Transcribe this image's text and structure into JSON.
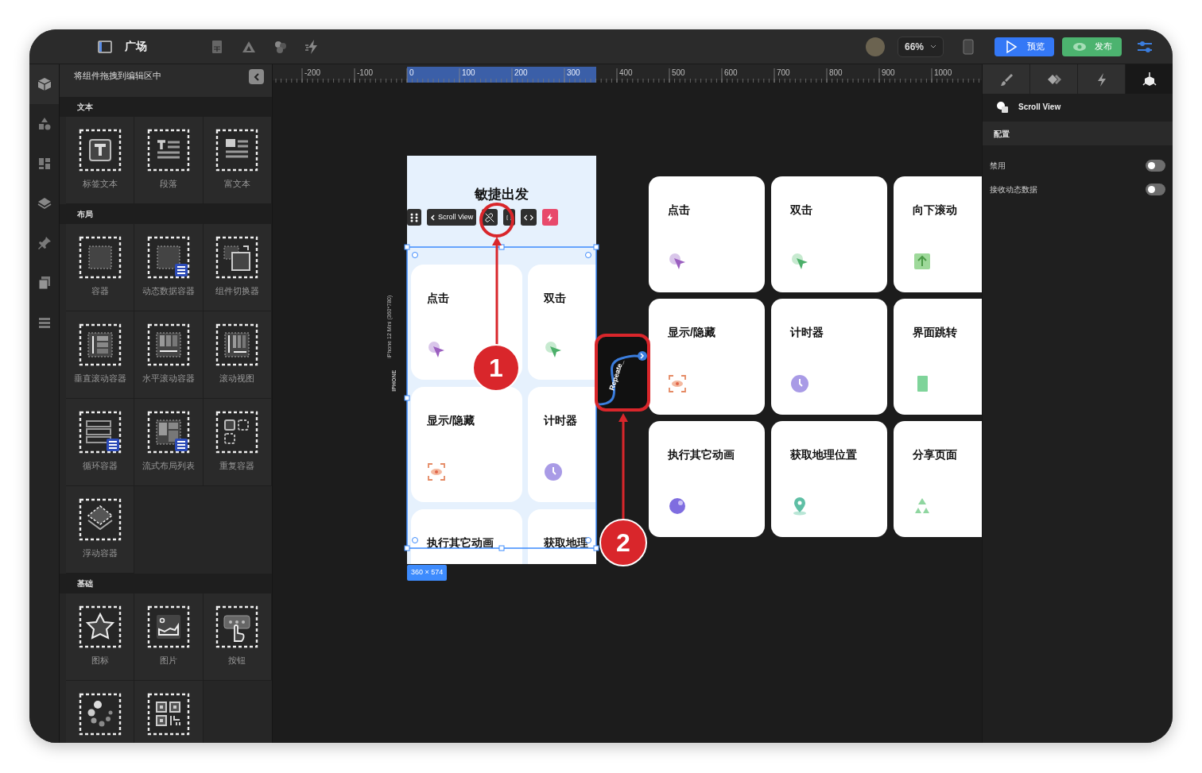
{
  "top_bar": {
    "title": "广场",
    "zoom": "66%",
    "buttons": [
      {
        "label": "预览",
        "kind": "preview"
      },
      {
        "label": "发布",
        "kind": "publish"
      }
    ]
  },
  "left_rail": [
    {
      "selected": true
    },
    {
      "selected": false
    },
    {
      "selected": false
    },
    {
      "selected": false
    },
    {
      "selected": false
    },
    {
      "selected": false
    },
    {
      "selected": false
    }
  ],
  "sidebar": {
    "title": "将组件拖拽到编辑区中",
    "sections": [
      {
        "title": "文本",
        "items": [
          {
            "label": "标签文本"
          },
          {
            "label": "段落"
          },
          {
            "label": "富文本"
          }
        ]
      },
      {
        "title": "布局",
        "items": [
          {
            "label": "容器"
          },
          {
            "label": "动态数据容器"
          },
          {
            "label": "组件切换器"
          },
          {
            "label": "垂直滚动容器"
          },
          {
            "label": "水平滚动容器"
          },
          {
            "label": "滚动视图"
          },
          {
            "label": "循环容器"
          },
          {
            "label": "流式布局列表"
          },
          {
            "label": "重复容器"
          },
          {
            "label": "浮动容器"
          }
        ]
      },
      {
        "title": "基础",
        "items": [
          {
            "label": "图标"
          },
          {
            "label": "图片"
          },
          {
            "label": "按钮"
          },
          {
            "kind": "unlabeled"
          },
          {
            "kind": "unlabeled"
          }
        ]
      }
    ]
  },
  "ruler": {
    "labels": [
      {
        "text": "-200",
        "selected": false
      },
      {
        "text": "-100",
        "selected": false
      },
      {
        "text": "0",
        "selected": true
      },
      {
        "text": "100",
        "selected": true
      },
      {
        "text": "200",
        "selected": true
      },
      {
        "text": "300",
        "selected": true
      },
      {
        "text": "400",
        "selected": false
      },
      {
        "text": "500",
        "selected": false
      },
      {
        "text": "600",
        "selected": false
      },
      {
        "text": "700",
        "selected": false
      },
      {
        "text": "800",
        "selected": false
      },
      {
        "text": "900",
        "selected": false
      },
      {
        "text": "1000",
        "selected": false
      }
    ]
  },
  "phone": {
    "platform": "IPHONE",
    "device": "iPhone 12 Mini (360*780)",
    "title": "敏捷出发",
    "toolbar_label": "Scroll View",
    "size": "360 × 574",
    "cards": [
      {
        "label": "点击"
      },
      {
        "label": "双击"
      },
      {
        "label": "显示/隐藏"
      },
      {
        "label": "计时器"
      },
      {
        "label": "执行其它动画"
      },
      {
        "label": "获取地理"
      }
    ]
  },
  "repeat_block": {
    "label": "Repeate_"
  },
  "preview_cards": [
    {
      "label": "点击"
    },
    {
      "label": "双击"
    },
    {
      "label": "向下滚动"
    },
    {
      "label": "显示/隐藏"
    },
    {
      "label": "计时器"
    },
    {
      "label": "界面跳转"
    },
    {
      "label": "执行其它动画"
    },
    {
      "label": "获取地理位置"
    },
    {
      "label": "分享页面"
    }
  ],
  "annotations": [
    {
      "number": "1"
    },
    {
      "number": "2"
    }
  ],
  "inspector": {
    "tabs": [
      {
        "selected": false
      },
      {
        "selected": false
      },
      {
        "selected": false
      },
      {
        "selected": true
      }
    ],
    "component": "Scroll View",
    "section": "配置",
    "settings": [
      {
        "label": "禁用",
        "on": false
      },
      {
        "label": "接收动态数据",
        "on": false
      }
    ]
  }
}
